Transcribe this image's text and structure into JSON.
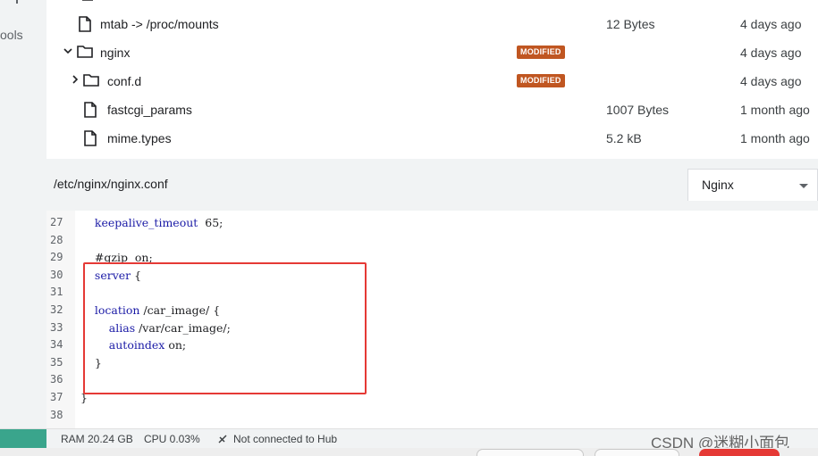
{
  "sidebar": {
    "tools_label": "ools"
  },
  "files": [
    {
      "name": "mtab -> /proc/mounts",
      "badge": "",
      "size": "12 Bytes",
      "date": "4 days ago",
      "type": "file",
      "expandable": false,
      "expanded": false
    },
    {
      "name": "nginx",
      "badge": "MODIFIED",
      "size": "",
      "date": "4 days ago",
      "type": "folder",
      "expandable": true,
      "expanded": true
    },
    {
      "name": "conf.d",
      "badge": "MODIFIED",
      "size": "",
      "date": "4 days ago",
      "type": "folder",
      "expandable": true,
      "expanded": false
    },
    {
      "name": "fastcgi_params",
      "badge": "",
      "size": "1007 Bytes",
      "date": "1 month ago",
      "type": "file",
      "expandable": false,
      "expanded": false
    },
    {
      "name": "mime.types",
      "badge": "",
      "size": "5.2 kB",
      "date": "1 month ago",
      "type": "file",
      "expandable": false,
      "expanded": false
    }
  ],
  "editor": {
    "path": "/etc/nginx/nginx.conf",
    "language": "Nginx",
    "lines": [
      {
        "n": "27",
        "text": "    keepalive_timeout  65;"
      },
      {
        "n": "28",
        "text": ""
      },
      {
        "n": "29",
        "text": "    #gzip  on;"
      },
      {
        "n": "30",
        "text": "    server {"
      },
      {
        "n": "31",
        "text": ""
      },
      {
        "n": "32",
        "text": "    location /car_image/ {"
      },
      {
        "n": "33",
        "text": "        alias /var/car_image/;"
      },
      {
        "n": "34",
        "text": "        autoindex on;"
      },
      {
        "n": "35",
        "text": "    }"
      },
      {
        "n": "36",
        "text": ""
      },
      {
        "n": "37",
        "text": "}"
      },
      {
        "n": "38",
        "text": ""
      }
    ]
  },
  "status": {
    "ram": "RAM 20.24 GB",
    "cpu": "CPU 0.03%",
    "hub": "Not connected to Hub"
  },
  "watermark": "CSDN @迷糊小面包",
  "colors": {
    "badge": "#c05621",
    "highlight": "#e53935",
    "status_accent": "#3aa58c"
  }
}
